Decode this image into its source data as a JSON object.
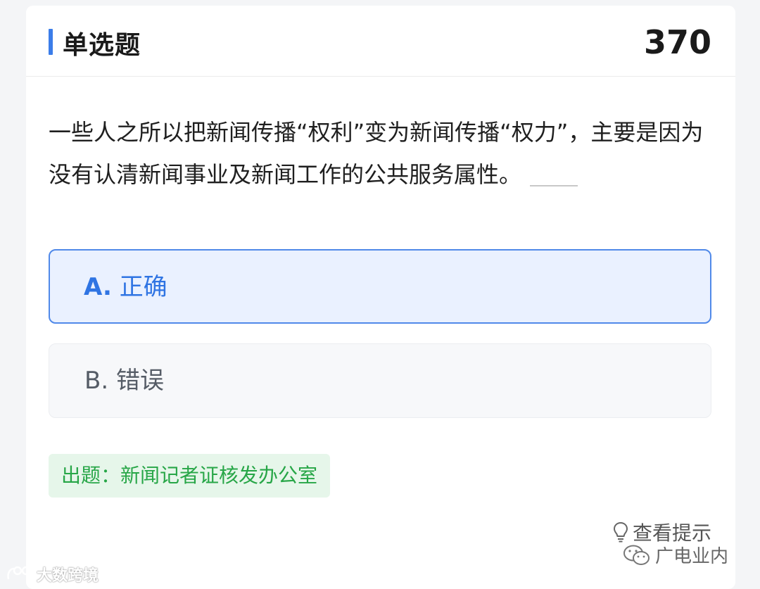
{
  "header": {
    "title": "单选题",
    "number": "370"
  },
  "question": {
    "text": "一些人之所以把新闻传播“权利”变为新闻传播“权力”，主要是因为没有认清新闻事业及新闻工作的公共服务属性。"
  },
  "options": [
    {
      "key": "A.",
      "label": "正确",
      "selected": true
    },
    {
      "key": "B.",
      "label": "错误",
      "selected": false
    }
  ],
  "source": "出题：新闻记者证核发办公室",
  "hint": {
    "label": "查看提示",
    "icon": "lightbulb-icon"
  },
  "watermarks": {
    "right": "广电业内",
    "left": "大数跨境"
  },
  "colors": {
    "accent": "#3b7de9",
    "selected_bg": "#eaf1ff",
    "source_green": "#27a647",
    "source_bg": "#e6f6ea"
  }
}
